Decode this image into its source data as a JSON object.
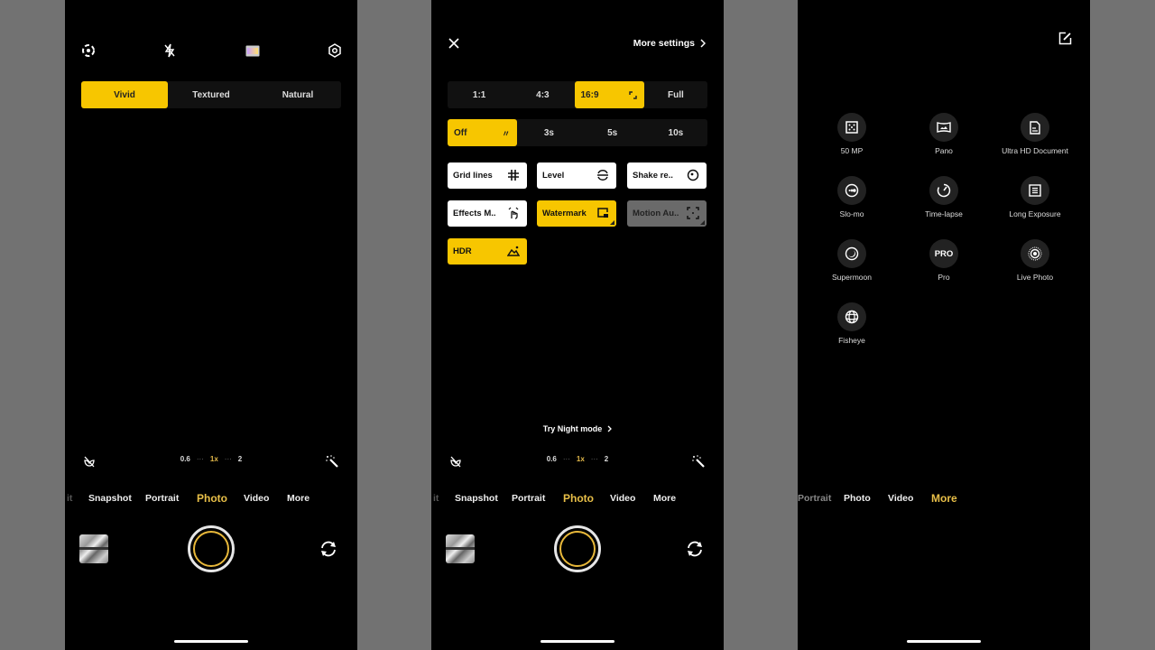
{
  "accent_color": "#f7c600",
  "phone1": {
    "top_icons": [
      "scan-icon",
      "flash-off-icon",
      "filter-icon",
      "settings-icon"
    ],
    "filters": [
      {
        "label": "Vivid",
        "selected": true
      },
      {
        "label": "Textured",
        "selected": false
      },
      {
        "label": "Natural",
        "selected": false
      }
    ],
    "zoom": {
      "levels": [
        "0.6",
        "1x",
        "2"
      ],
      "current": "1x",
      "dots": "···"
    },
    "modes": [
      "it",
      "Snapshot",
      "Portrait",
      "Photo",
      "Video",
      "More"
    ],
    "active_mode": "Photo"
  },
  "phone2": {
    "close_icon": "close-icon",
    "more_settings": "More settings",
    "aspect_ratios": [
      {
        "label": "1:1",
        "selected": false
      },
      {
        "label": "4:3",
        "selected": false
      },
      {
        "label": "16:9",
        "selected": true
      },
      {
        "label": "Full",
        "selected": false
      }
    ],
    "timers": [
      {
        "label": "Off",
        "selected": true
      },
      {
        "label": "3s",
        "selected": false
      },
      {
        "label": "5s",
        "selected": false
      },
      {
        "label": "10s",
        "selected": false
      }
    ],
    "toggles": [
      {
        "label": "Grid lines",
        "state": "off",
        "icon": "grid-icon"
      },
      {
        "label": "Level",
        "state": "off",
        "icon": "level-icon"
      },
      {
        "label": "Shake re..",
        "state": "off",
        "icon": "shake-reduction-icon"
      },
      {
        "label": "Effects M..",
        "state": "off",
        "icon": "gesture-icon"
      },
      {
        "label": "Watermark",
        "state": "on",
        "icon": "watermark-icon"
      },
      {
        "label": "Motion Au..",
        "state": "disabled",
        "icon": "focus-frame-icon"
      },
      {
        "label": "HDR",
        "state": "on",
        "icon": "hdr-icon"
      }
    ],
    "night_hint": "Try Night mode",
    "zoom": {
      "levels": [
        "0.6",
        "1x",
        "2"
      ],
      "current": "1x",
      "dots": "···"
    },
    "modes": [
      "it",
      "Snapshot",
      "Portrait",
      "Photo",
      "Video",
      "More"
    ],
    "active_mode": "Photo"
  },
  "phone3": {
    "edit_icon": "edit-icon",
    "more_modes": [
      {
        "label": "50 MP",
        "icon": "50mp-icon"
      },
      {
        "label": "Pano",
        "icon": "pano-icon"
      },
      {
        "label": "Ultra HD Document",
        "icon": "document-icon"
      },
      {
        "label": "Slo-mo",
        "icon": "slomo-icon"
      },
      {
        "label": "Time-lapse",
        "icon": "timelapse-icon"
      },
      {
        "label": "Long Exposure",
        "icon": "long-exposure-icon"
      },
      {
        "label": "Supermoon",
        "icon": "supermoon-icon"
      },
      {
        "label": "Pro",
        "icon": "pro-icon",
        "glyph": "PRO"
      },
      {
        "label": "Live Photo",
        "icon": "live-photo-icon"
      },
      {
        "label": "Fisheye",
        "icon": "fisheye-icon"
      }
    ],
    "modes": [
      "Portrait",
      "Photo",
      "Video",
      "More"
    ],
    "active_mode": "More"
  }
}
